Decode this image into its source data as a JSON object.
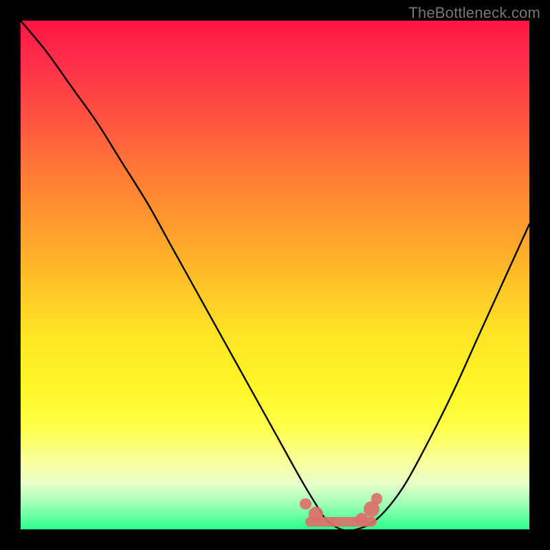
{
  "attribution": "TheBottleneck.com",
  "colors": {
    "frame_bg": "#000000",
    "curve": "#000000",
    "marker": "#dd6f6a",
    "gradient_top": "#ff1644",
    "gradient_bottom": "#2bff8c"
  },
  "chart_data": {
    "type": "line",
    "title": "",
    "xlabel": "",
    "ylabel": "",
    "xlim": [
      0,
      100
    ],
    "ylim": [
      0,
      100
    ],
    "gradient_meaning": "background encodes bottleneck severity: red=high, yellow=medium, green=low",
    "series": [
      {
        "name": "bottleneck-curve",
        "x": [
          0,
          5,
          10,
          15,
          20,
          25,
          30,
          35,
          40,
          45,
          50,
          55,
          58,
          60,
          63,
          66,
          70,
          75,
          80,
          85,
          90,
          95,
          100
        ],
        "y": [
          100,
          94,
          87,
          80,
          72,
          64,
          55,
          46,
          37,
          28,
          19,
          10,
          5,
          2,
          0,
          0,
          2,
          8,
          17,
          27,
          38,
          49,
          60
        ]
      }
    ],
    "sweet_spot": {
      "x_start": 56,
      "x_end": 70,
      "y": 1.5
    },
    "markers": [
      {
        "x": 56,
        "y": 5,
        "r": 1.1
      },
      {
        "x": 58,
        "y": 3,
        "r": 1.4
      },
      {
        "x": 67,
        "y": 2,
        "r": 1.2
      },
      {
        "x": 69,
        "y": 4,
        "r": 1.6
      },
      {
        "x": 70,
        "y": 6,
        "r": 1.1
      }
    ]
  }
}
